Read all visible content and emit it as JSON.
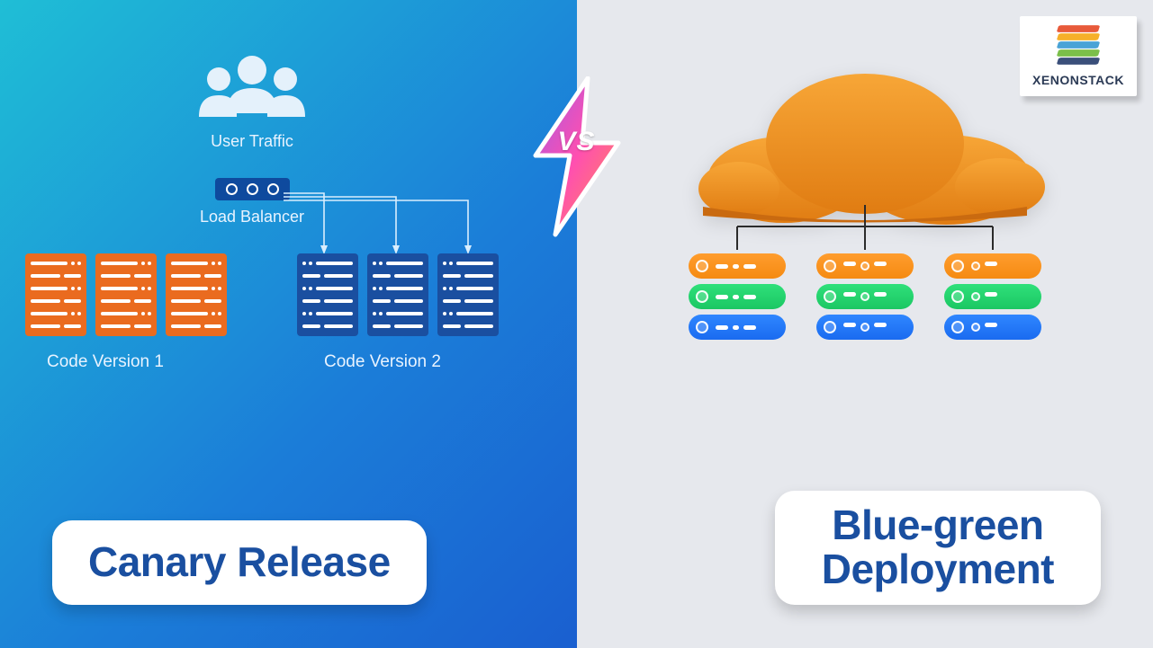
{
  "logo_text": "XENONSTACK",
  "logo_layers": [
    "#e85a3a",
    "#f6b02a",
    "#4aa3d6",
    "#7bbf4a",
    "#3a4f7a"
  ],
  "vs_label": "VS",
  "left": {
    "user_traffic_label": "User Traffic",
    "load_balancer_label": "Load Balancer",
    "code_v1_label": "Code Version 1",
    "code_v2_label": "Code Version 2",
    "title": "Canary Release"
  },
  "right": {
    "title_line1": "Blue-green",
    "title_line2": "Deployment",
    "rack_colors": [
      "orange",
      "green",
      "blue"
    ]
  }
}
